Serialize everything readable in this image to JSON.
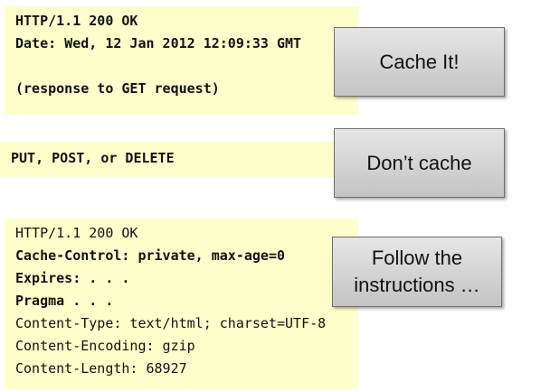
{
  "blocks": [
    {
      "lines": [
        "HTTP/1.1 200 OK",
        "Date: Wed, 12 Jan 2012 12:09:33 GMT",
        "",
        "(response to GET request)"
      ],
      "action": "Cache It!"
    },
    {
      "lines": [
        "PUT, POST, or DELETE"
      ],
      "action": "Don’t cache"
    },
    {
      "lines": [
        "HTTP/1.1 200 OK",
        "Cache-Control: private, max-age=0",
        "Expires: . . .",
        "Pragma . . .",
        "Content-Type: text/html; charset=UTF-8",
        "Content-Encoding: gzip",
        "Content-Length: 68927"
      ],
      "action_line1": "Follow the",
      "action_line2": "instructions …"
    }
  ],
  "colors": {
    "code_background": "#ffffcc",
    "button_gradient_top": "#e6e6e6",
    "button_gradient_bottom": "#c4c4c4",
    "button_border": "#6e6e6e",
    "text": "#111111"
  }
}
